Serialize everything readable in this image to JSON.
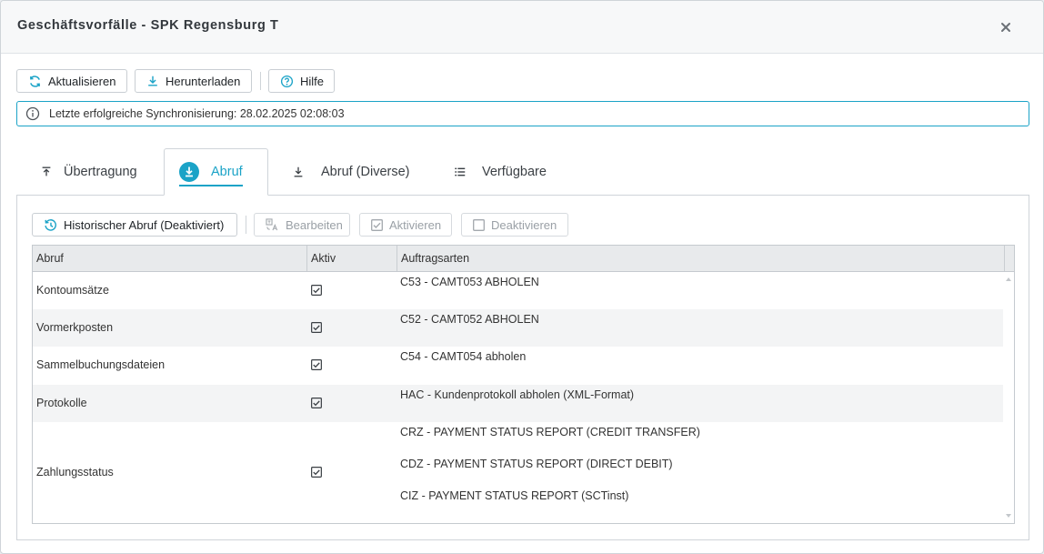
{
  "window": {
    "title": "Geschäftsvorfälle - SPK Regensburg T",
    "close_icon": "close-icon"
  },
  "toolbar": {
    "refresh_label": "Aktualisieren",
    "download_label": "Herunterladen",
    "help_label": "Hilfe"
  },
  "info": {
    "text": "Letzte erfolgreiche Synchronisierung: 28.02.2025 02:08:03"
  },
  "tabs": [
    {
      "label": "Übertragung",
      "icon": "upload-icon",
      "active": false
    },
    {
      "label": "Abruf",
      "icon": "download-circle-icon",
      "active": true
    },
    {
      "label": "Abruf (Diverse)",
      "icon": "download-icon",
      "active": false
    },
    {
      "label": "Verfügbare",
      "icon": "list-icon",
      "active": false
    }
  ],
  "panel_toolbar": {
    "history_label": "Historischer Abruf (Deaktiviert)",
    "edit_label": "Bearbeiten",
    "activate_label": "Aktivieren",
    "deactivate_label": "Deaktivieren"
  },
  "grid": {
    "columns": [
      "Abruf",
      "Aktiv",
      "Auftragsarten"
    ],
    "rows": [
      {
        "abruf": "Kontoumsätze",
        "aktiv": true,
        "auftragsarten": [
          "C53 - CAMT053 ABHOLEN"
        ]
      },
      {
        "abruf": "Vormerkposten",
        "aktiv": true,
        "auftragsarten": [
          "C52 - CAMT052 ABHOLEN"
        ]
      },
      {
        "abruf": "Sammelbuchungsdateien",
        "aktiv": true,
        "auftragsarten": [
          "C54 - CAMT054 abholen"
        ]
      },
      {
        "abruf": "Protokolle",
        "aktiv": true,
        "auftragsarten": [
          "HAC - Kundenprotokoll abholen (XML-Format)"
        ]
      },
      {
        "abruf": "Zahlungsstatus",
        "aktiv": true,
        "auftragsarten": [
          "CRZ - PAYMENT STATUS REPORT (CREDIT TRANSFER)",
          "CDZ - PAYMENT STATUS REPORT (DIRECT DEBIT)",
          "CIZ - PAYMENT STATUS REPORT (SCTinst)"
        ]
      }
    ]
  },
  "colors": {
    "accent": "#1ba3c7",
    "border": "#cfd4d9",
    "header_bg": "#e8eaec"
  }
}
